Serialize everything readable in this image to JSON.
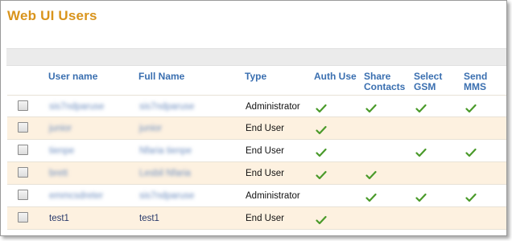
{
  "page": {
    "title": "Web UI Users"
  },
  "table": {
    "headers": {
      "username": "User name",
      "fullname": "Full Name",
      "type": "Type",
      "auth_use": "Auth Use",
      "share_contacts_1": "Share",
      "share_contacts_2": "Contacts",
      "select_gsm_1": "Select",
      "select_gsm_2": "GSM",
      "send_mms_1": "Send",
      "send_mms_2": "MMS"
    },
    "rows": [
      {
        "username": "sis7ndparuse",
        "fullname": "sis7ndparuse",
        "type": "Administrator",
        "auth_use": true,
        "share_contacts": true,
        "select_gsm": true,
        "send_mms": true
      },
      {
        "username": "junior",
        "fullname": "junior",
        "type": "End User",
        "auth_use": true,
        "share_contacts": false,
        "select_gsm": false,
        "send_mms": false
      },
      {
        "username": "tienpe",
        "fullname": "Nfaria tienpe",
        "type": "End User",
        "auth_use": true,
        "share_contacts": false,
        "select_gsm": true,
        "send_mms": true
      },
      {
        "username": "brett",
        "fullname": "Lesbil Nfaria",
        "type": "End User",
        "auth_use": true,
        "share_contacts": true,
        "select_gsm": false,
        "send_mms": false
      },
      {
        "username": "emmcsdreter",
        "fullname": "sis7ndparuse",
        "type": "Administrator",
        "auth_use": false,
        "share_contacts": true,
        "select_gsm": true,
        "send_mms": true
      },
      {
        "username": "test1",
        "fullname": "test1",
        "type": "End User",
        "auth_use": true,
        "share_contacts": false,
        "select_gsm": false,
        "send_mms": false
      }
    ]
  },
  "colors": {
    "title": "#d9941c",
    "header": "#3a6fb0",
    "check": "#4a9a2a",
    "alt_row": "#fdf1e0"
  }
}
